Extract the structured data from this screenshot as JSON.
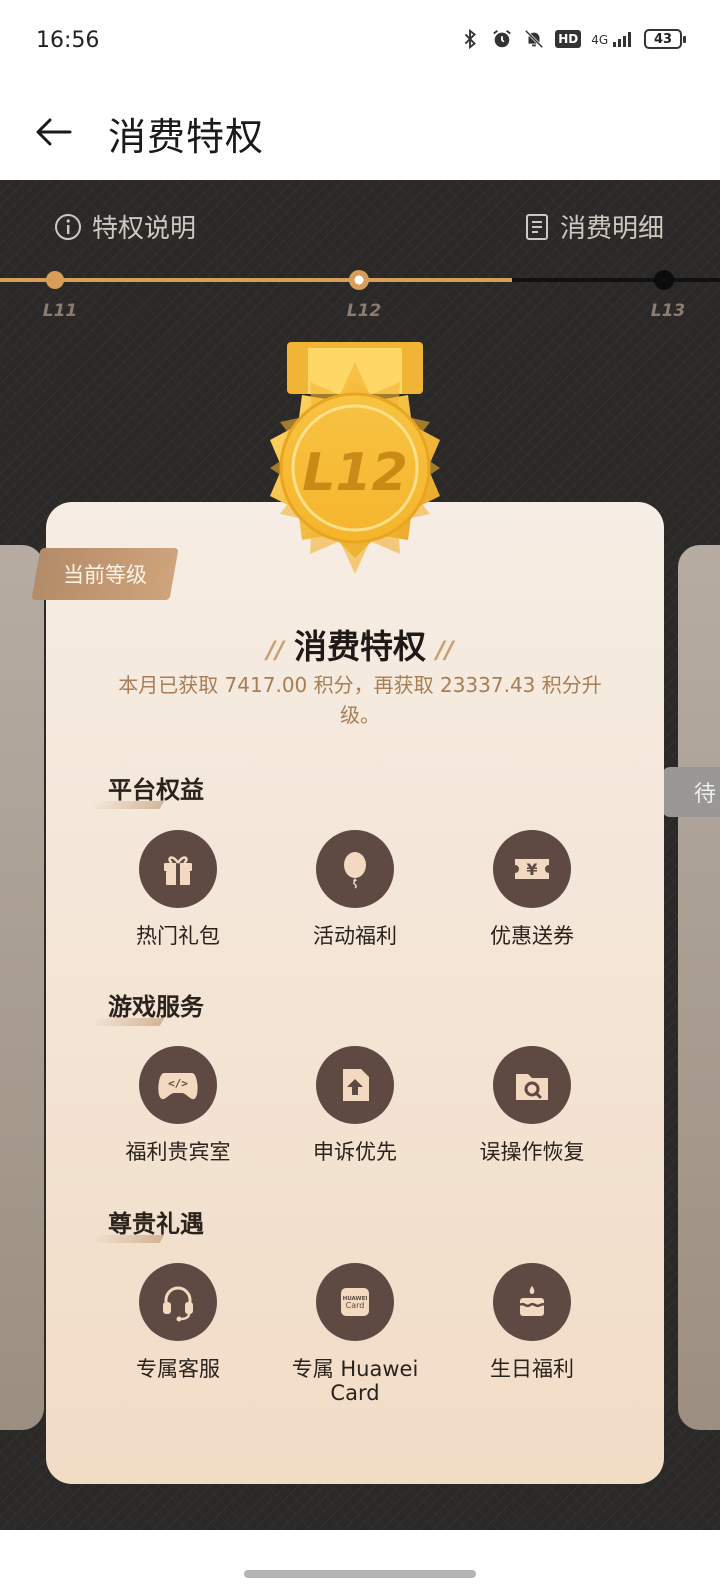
{
  "status": {
    "time": "16:56",
    "network": "4G",
    "hd": "HD",
    "battery": "43"
  },
  "appbar": {
    "title": "消费特权"
  },
  "header": {
    "left_label": "特权说明",
    "right_label": "消费明细"
  },
  "levels": {
    "items": [
      "L11",
      "L12",
      "L13"
    ],
    "current": "L12"
  },
  "medal": {
    "level": "L12"
  },
  "card": {
    "current_tag": "当前等级",
    "title": "消费特权",
    "subtitle": "本月已获取 7417.00 积分，再获取 23337.43 积分升级。",
    "next_tag": "待"
  },
  "sections": [
    {
      "title": "平台权益",
      "items": [
        {
          "label": "热门礼包",
          "icon": "gift-icon"
        },
        {
          "label": "活动福利",
          "icon": "balloon-icon"
        },
        {
          "label": "优惠送券",
          "icon": "coupon-icon"
        }
      ]
    },
    {
      "title": "游戏服务",
      "items": [
        {
          "label": "福利贵宾室",
          "icon": "gamepad-icon"
        },
        {
          "label": "申诉优先",
          "icon": "appeal-icon"
        },
        {
          "label": "误操作恢复",
          "icon": "folder-search-icon"
        }
      ]
    },
    {
      "title": "尊贵礼遇",
      "items": [
        {
          "label": "专属客服",
          "icon": "headset-icon"
        },
        {
          "label": "专属 Huawei Card",
          "icon": "card-icon",
          "card_text": "HUAWEI Card"
        },
        {
          "label": "生日福利",
          "icon": "cake-icon"
        }
      ]
    }
  ],
  "colors": {
    "accent": "#d79e5a",
    "dark": "#2b2927",
    "icon_bg": "#5e4a42",
    "sub_text": "#a77d55"
  }
}
